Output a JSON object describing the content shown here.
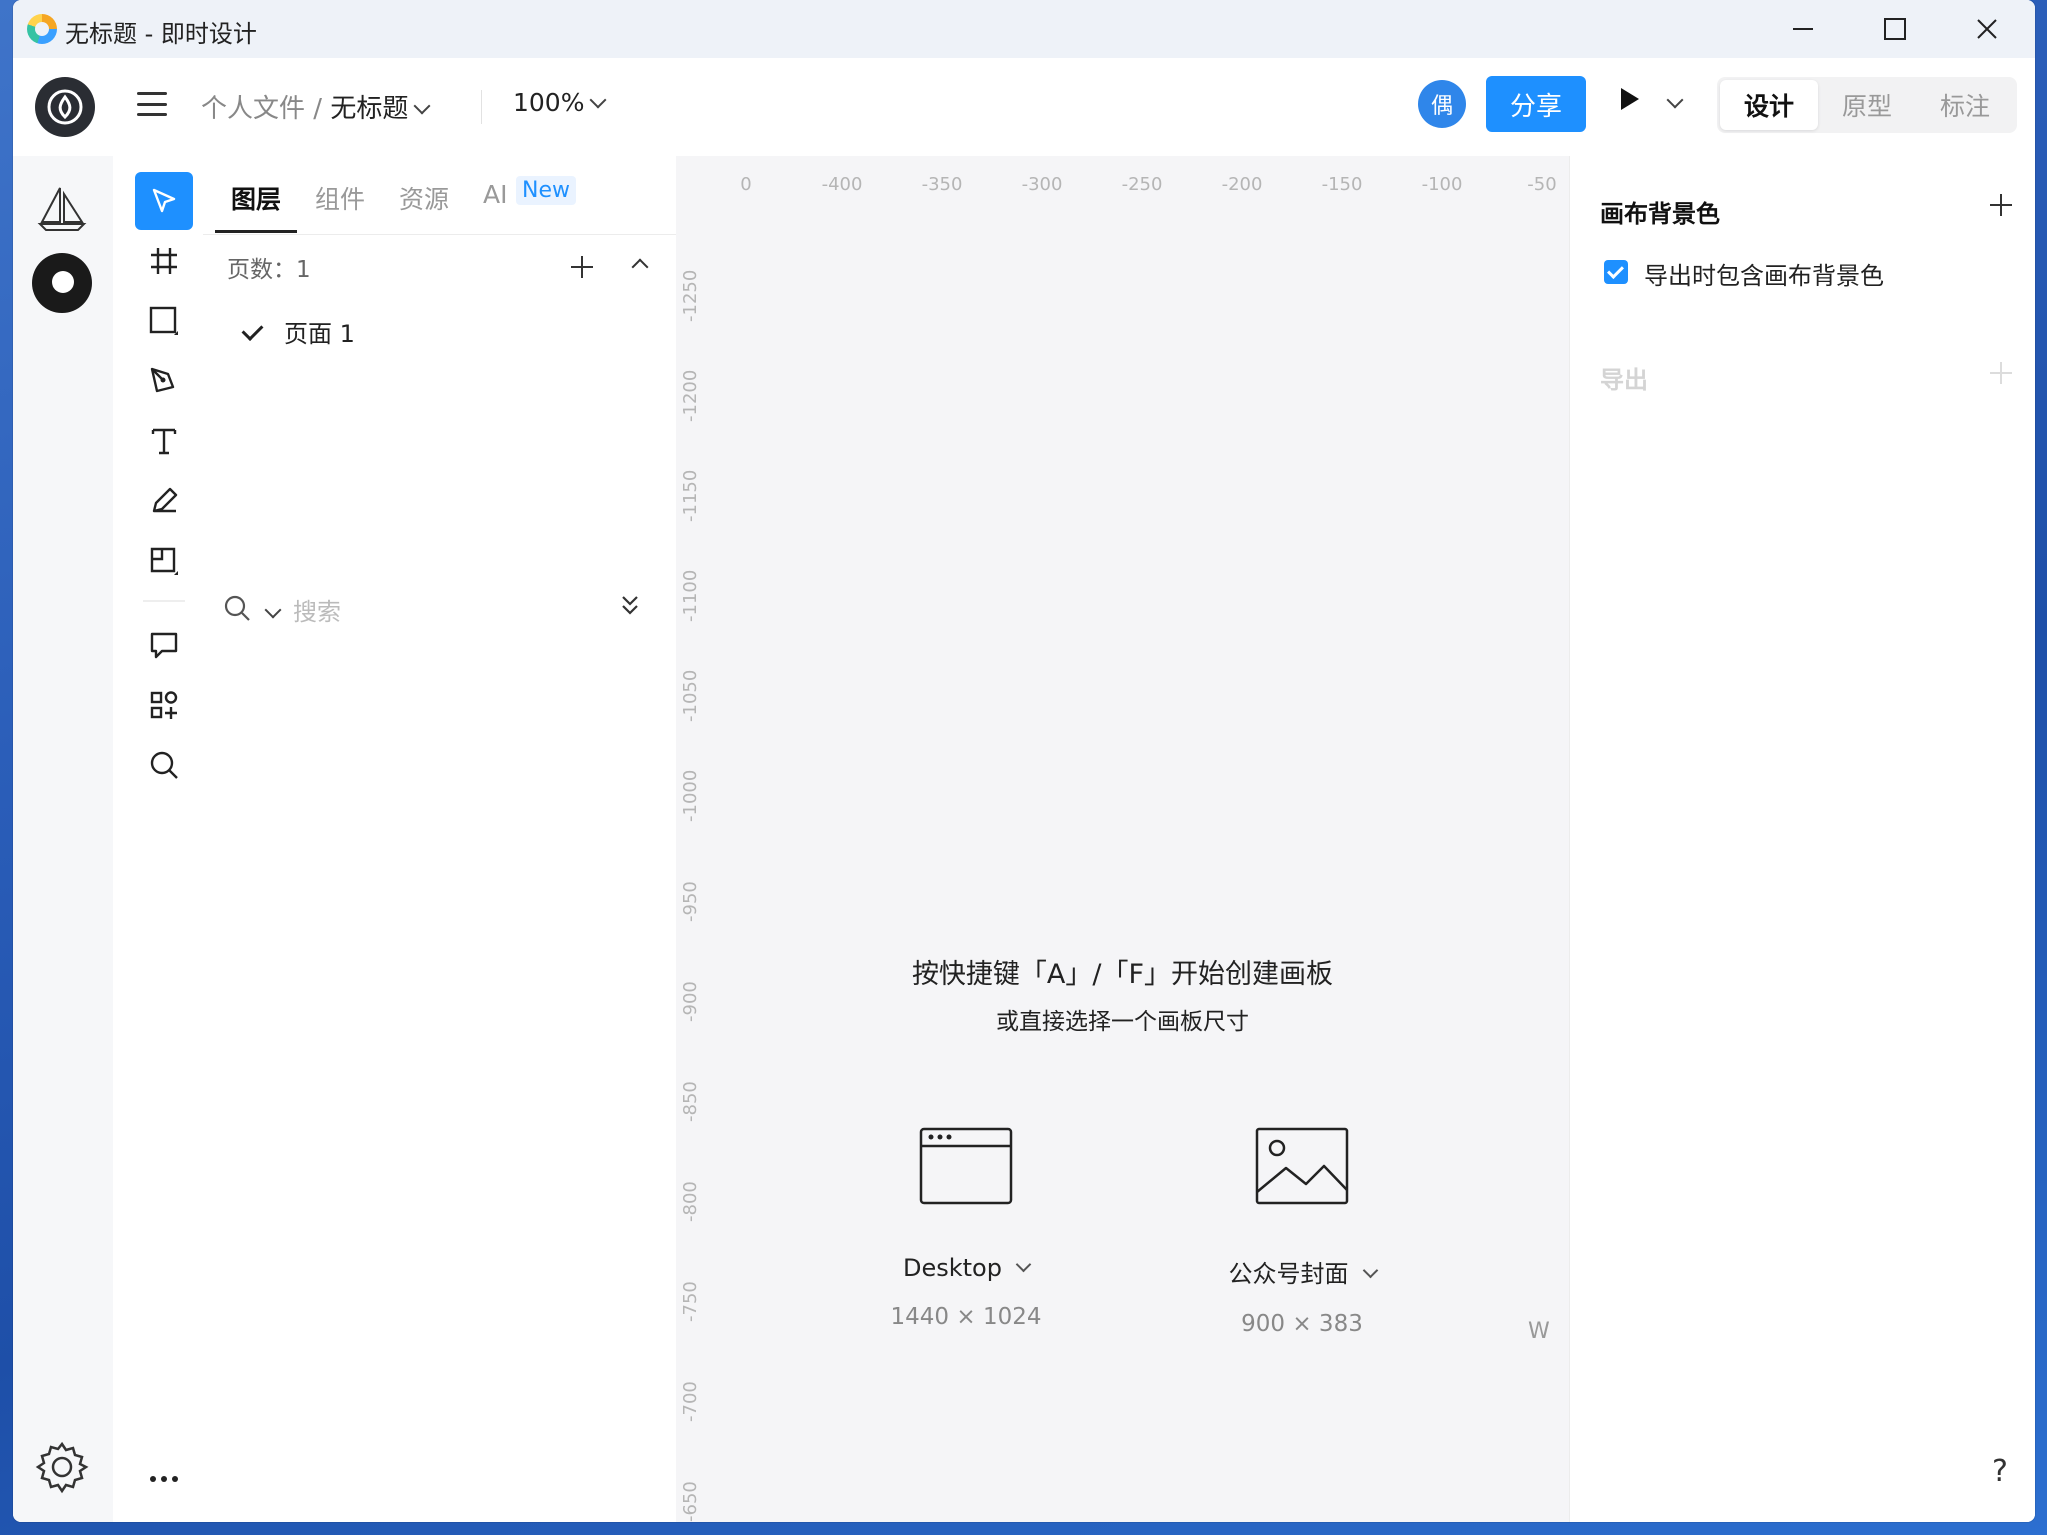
{
  "window": {
    "title": "无标题 - 即时设计"
  },
  "topbar": {
    "breadcrumb_root": "个人文件",
    "breadcrumb_sep": " / ",
    "breadcrumb_current": "无标题",
    "zoom": "100%",
    "avatar_initial": "偶",
    "share_label": "分享",
    "modes": [
      "设计",
      "原型",
      "标注"
    ],
    "active_mode": "设计"
  },
  "layers_panel": {
    "tabs": [
      "图层",
      "组件",
      "资源",
      "AI"
    ],
    "new_badge": "New",
    "pages_label": "页数：1",
    "pages": [
      {
        "name": "页面 1",
        "selected": true
      }
    ],
    "search_placeholder": "搜索"
  },
  "canvas": {
    "ruler_top": [
      "-400",
      "-350",
      "-300",
      "-250",
      "-200",
      "-150",
      "-100",
      "-50"
    ],
    "ruler_left": [
      "-1250",
      "-1200",
      "-1150",
      "-1100",
      "-1050",
      "-1000",
      "-950",
      "-900",
      "-850",
      "-800",
      "-750",
      "-700",
      "-650"
    ],
    "hint_main": "按快捷键「A」/「F」开始创建画板",
    "hint_sub": "或直接选择一个画板尺寸",
    "presets": [
      {
        "label": "Desktop",
        "size": "1440 × 1024",
        "icon": "browser-window-icon"
      },
      {
        "label": "公众号封面",
        "size": "900 × 383",
        "icon": "image-icon"
      }
    ],
    "overflow_mark": "W"
  },
  "right_panel": {
    "canvas_bg_title": "画布背景色",
    "include_bg_label": "导出时包含画布背景色",
    "include_bg_checked": true,
    "export_title": "导出"
  },
  "colors": {
    "accent": "#1e90ff",
    "avatar": "#2f86ea"
  },
  "help_label": "?"
}
